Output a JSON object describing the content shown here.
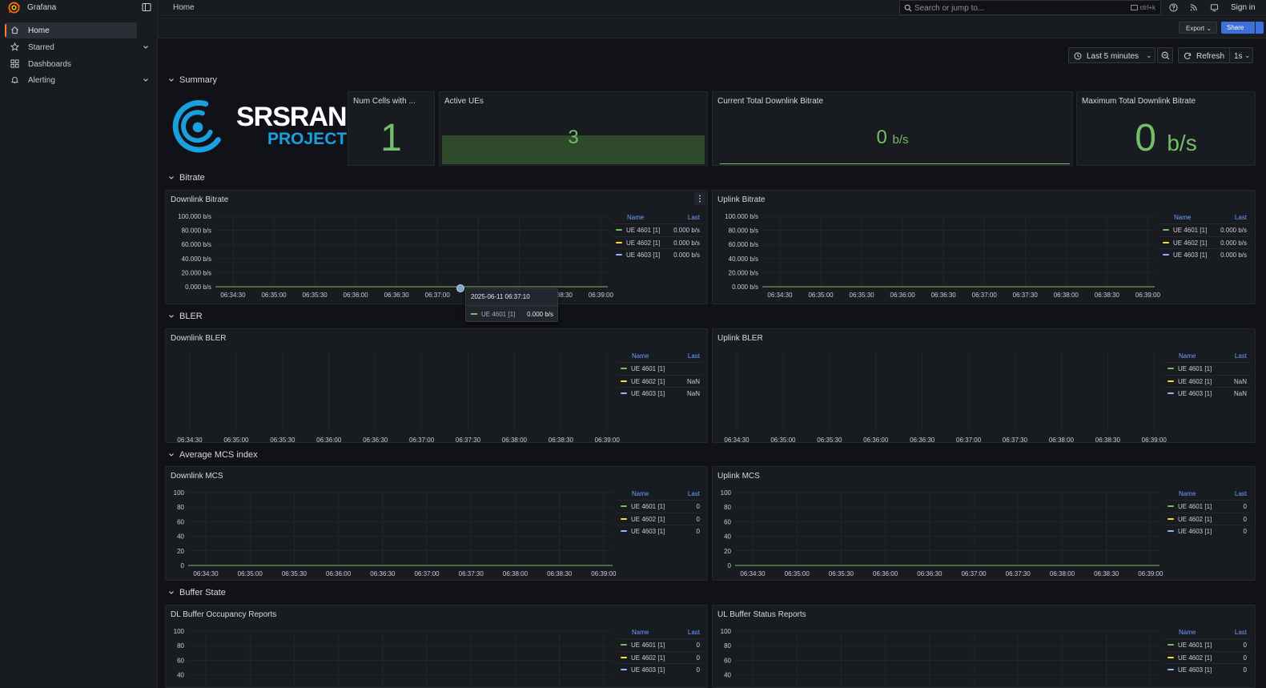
{
  "app": {
    "name": "Grafana"
  },
  "nav": [
    {
      "label": "Home",
      "icon": "home-icon",
      "active": true,
      "expandable": false
    },
    {
      "label": "Starred",
      "icon": "star-icon",
      "active": false,
      "expandable": true
    },
    {
      "label": "Dashboards",
      "icon": "dashboards-icon",
      "active": false,
      "expandable": false
    },
    {
      "label": "Alerting",
      "icon": "bell-icon",
      "active": false,
      "expandable": true
    }
  ],
  "topbar": {
    "breadcrumb": "Home",
    "search_placeholder": "Search or jump to...",
    "shortcut": "ctrl+k",
    "sign_in": "Sign in"
  },
  "toolbar": {
    "export_label": "Export",
    "share_label": "Share"
  },
  "time": {
    "range_label": "Last 5 minutes",
    "refresh_label": "Refresh",
    "interval_label": "1s"
  },
  "rows": {
    "summary": "Summary",
    "bitrate": "Bitrate",
    "bler": "BLER",
    "mcs": "Average MCS index",
    "buffer": "Buffer State"
  },
  "logo": {
    "line1": "SRSRAN",
    "line2": "PROJECT",
    "color": "#1aa0e0"
  },
  "stats": {
    "cells": {
      "title": "Num Cells with ...",
      "value": "1"
    },
    "ues": {
      "title": "Active UEs",
      "value": "3",
      "level": 1.0
    },
    "cur_dl": {
      "title": "Current Total Downlink Bitrate",
      "value": "0",
      "unit": "b/s"
    },
    "max_dl": {
      "title": "Maximum Total Downlink Bitrate",
      "value": "0",
      "unit": "b/s"
    }
  },
  "colors": {
    "ue1": "#73bf69",
    "ue2": "#fade2a",
    "ue3": "#8ab8ff",
    "stat": "#73bf69"
  },
  "legend": {
    "name_header": "Name",
    "last_header": "Last"
  },
  "x_ticks": [
    "06:34:30",
    "06:35:00",
    "06:35:30",
    "06:36:00",
    "06:36:30",
    "06:37:00",
    "06:37:30",
    "06:38:00",
    "06:38:30",
    "06:39:00"
  ],
  "panels": {
    "dl_bitrate": {
      "title": "Downlink Bitrate",
      "y_ticks": [
        "100.000 b/s",
        "80.000 b/s",
        "60.000 b/s",
        "40.000 b/s",
        "20.000 b/s",
        "0.000 b/s"
      ],
      "legend": [
        {
          "name": "UE 4601 [1]",
          "last": "0.000 b/s"
        },
        {
          "name": "UE 4602 [1]",
          "last": "0.000 b/s"
        },
        {
          "name": "UE 4603 [1]",
          "last": "0.000 b/s"
        }
      ]
    },
    "ul_bitrate": {
      "title": "Uplink Bitrate",
      "y_ticks": [
        "100.000 b/s",
        "80.000 b/s",
        "60.000 b/s",
        "40.000 b/s",
        "20.000 b/s",
        "0.000 b/s"
      ],
      "legend": [
        {
          "name": "UE 4601 [1]",
          "last": "0.000 b/s"
        },
        {
          "name": "UE 4602 [1]",
          "last": "0.000 b/s"
        },
        {
          "name": "UE 4603 [1]",
          "last": "0.000 b/s"
        }
      ]
    },
    "dl_bler": {
      "title": "Downlink BLER",
      "y_ticks": [],
      "legend": [
        {
          "name": "UE 4601 [1]",
          "last": ""
        },
        {
          "name": "UE 4602 [1]",
          "last": "NaN"
        },
        {
          "name": "UE 4603 [1]",
          "last": "NaN"
        }
      ]
    },
    "ul_bler": {
      "title": "Uplink BLER",
      "y_ticks": [],
      "legend": [
        {
          "name": "UE 4601 [1]",
          "last": ""
        },
        {
          "name": "UE 4602 [1]",
          "last": "NaN"
        },
        {
          "name": "UE 4603 [1]",
          "last": "NaN"
        }
      ]
    },
    "dl_mcs": {
      "title": "Downlink MCS",
      "y_ticks": [
        "100",
        "80",
        "60",
        "40",
        "20",
        "0"
      ],
      "legend": [
        {
          "name": "UE 4601 [1]",
          "last": "0"
        },
        {
          "name": "UE 4602 [1]",
          "last": "0"
        },
        {
          "name": "UE 4603 [1]",
          "last": "0"
        }
      ]
    },
    "ul_mcs": {
      "title": "Uplink MCS",
      "y_ticks": [
        "100",
        "80",
        "60",
        "40",
        "20",
        "0"
      ],
      "legend": [
        {
          "name": "UE 4601 [1]",
          "last": "0"
        },
        {
          "name": "UE 4602 [1]",
          "last": "0"
        },
        {
          "name": "UE 4603 [1]",
          "last": "0"
        }
      ]
    },
    "dl_buffer": {
      "title": "DL Buffer Occupancy Reports",
      "y_ticks": [
        "100",
        "80",
        "60",
        "40"
      ],
      "legend": [
        {
          "name": "UE 4601 [1]",
          "last": "0"
        },
        {
          "name": "UE 4602 [1]",
          "last": "0"
        },
        {
          "name": "UE 4603 [1]",
          "last": "0"
        }
      ]
    },
    "ul_buffer": {
      "title": "UL Buffer Status Reports",
      "y_ticks": [
        "100",
        "80",
        "60",
        "40"
      ],
      "legend": [
        {
          "name": "UE 4601 [1]",
          "last": "0"
        },
        {
          "name": "UE 4602 [1]",
          "last": "0"
        },
        {
          "name": "UE 4603 [1]",
          "last": "0"
        }
      ]
    }
  },
  "tooltip": {
    "time": "2025-06-11 06:37:10",
    "series": "UE 4601 [1]",
    "value": "0.000 b/s"
  }
}
